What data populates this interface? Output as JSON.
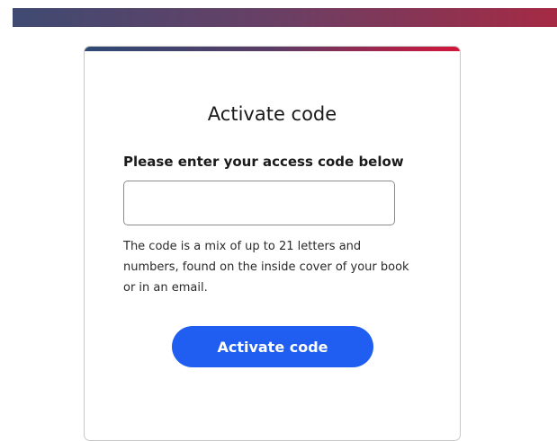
{
  "card": {
    "title": "Activate code",
    "field_label": "Please enter your access code below",
    "input_value": "",
    "input_placeholder": "",
    "help_text": "The code is a mix of up to 21 letters and numbers, found on the inside cover of your book or in an email.",
    "button_label": "Activate code"
  },
  "colors": {
    "button": "#1f5ef0",
    "banner_start": "#3f4a72",
    "banner_end": "#a52a44",
    "accent_end": "#d3163b"
  }
}
